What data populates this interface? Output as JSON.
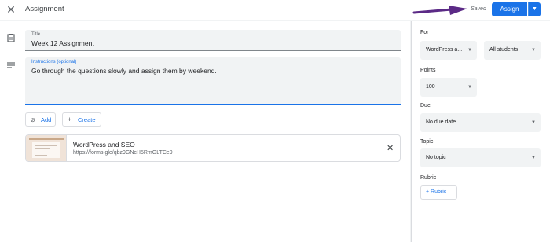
{
  "header": {
    "title": "Assignment",
    "saved": "Saved",
    "assign_label": "Assign",
    "close_icon": "close-icon",
    "dropdown_icon": "caret-down-icon"
  },
  "form": {
    "title_label": "Title",
    "title_value": "Week 12 Assignment",
    "instructions_label": "Instructions (optional)",
    "instructions_value": "Go through the questions slowly and assign them by weekend.",
    "add_label": "Add",
    "create_label": "Create"
  },
  "attachment": {
    "title": "WordPress and SEO",
    "url": "https://forms.gle/qbz9GNcH5RmGLTCe9"
  },
  "sidebar": {
    "for_label": "For",
    "class_value": "WordPress a...",
    "students_value": "All students",
    "points_label": "Points",
    "points_value": "100",
    "due_label": "Due",
    "due_value": "No due date",
    "topic_label": "Topic",
    "topic_value": "No topic",
    "rubric_label": "Rubric",
    "rubric_button": "Rubric"
  },
  "colors": {
    "accent": "#1a73e8",
    "arrow": "#5b2a86"
  }
}
